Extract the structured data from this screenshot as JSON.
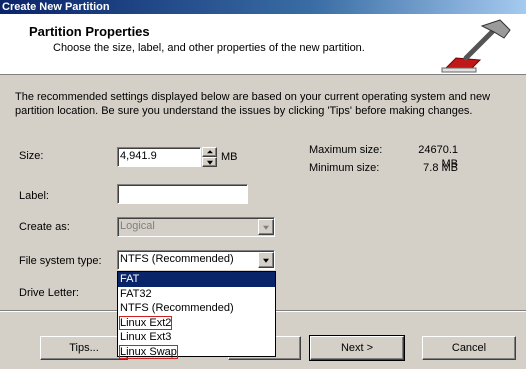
{
  "window": {
    "title": "Create New Partition"
  },
  "header": {
    "title": "Partition Properties",
    "subtitle": "Choose the size, label, and other properties of the new partition.",
    "icon": "hammer-icon"
  },
  "description": "The recommended settings displayed below are based on your current operating system and new partition location. Be sure you understand the issues by clicking 'Tips' before making changes.",
  "form": {
    "size_label": "Size:",
    "size_value": "4,941.9",
    "size_unit": "MB",
    "label_label": "Label:",
    "label_value": "",
    "create_as_label": "Create as:",
    "create_as_value": "Logical",
    "fs_type_label": "File system type:",
    "fs_type_value": "NTFS (Recommended)",
    "drive_letter_label": "Drive Letter:"
  },
  "size_info": {
    "max_label": "Maximum size:",
    "max_value": "24670.1 MB",
    "min_label": "Minimum size:",
    "min_value": "7.8 MB"
  },
  "fs_options": [
    {
      "label": "FAT",
      "selected": true,
      "outlined": false
    },
    {
      "label": "FAT32",
      "selected": false,
      "outlined": false
    },
    {
      "label": "NTFS (Recommended)",
      "selected": false,
      "outlined": false
    },
    {
      "label": "Linux Ext2",
      "selected": false,
      "outlined": true
    },
    {
      "label": "Linux Ext3",
      "selected": false,
      "outlined": false
    },
    {
      "label": "Linux Swap",
      "selected": false,
      "outlined": true
    }
  ],
  "buttons": {
    "tips": "Tips...",
    "next": "Next >",
    "cancel": "Cancel"
  },
  "colors": {
    "selection": "#0a246a",
    "outline_highlight": "#d02020",
    "face": "#d4d0c8"
  }
}
